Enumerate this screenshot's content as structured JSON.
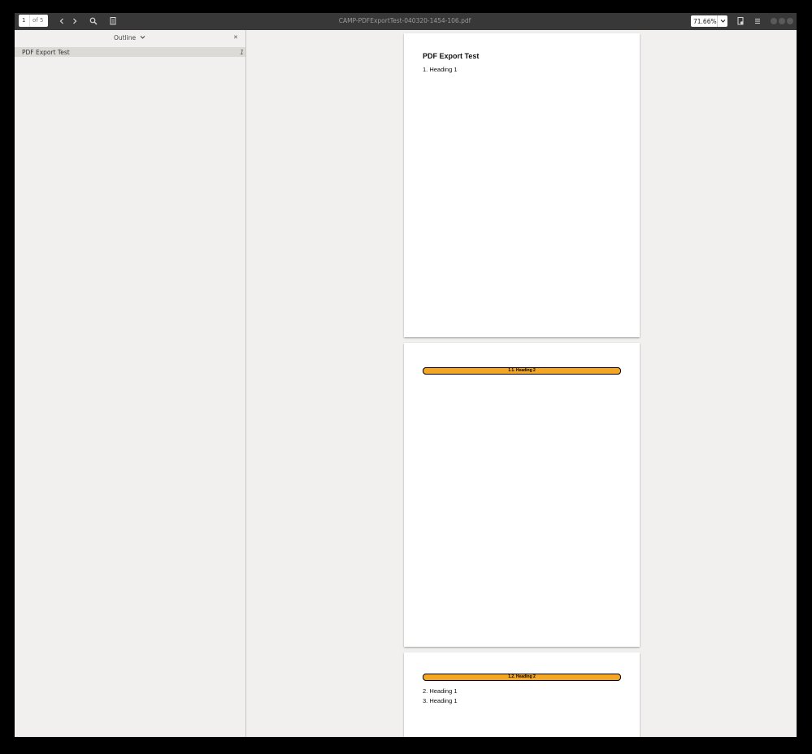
{
  "toolbar": {
    "page_number": "1",
    "page_count": "of 5",
    "title": "CAMP-PDFExportTest-040320-1454-106.pdf",
    "zoom": "71.66%"
  },
  "sidebar": {
    "mode": "Outline",
    "items": [
      {
        "label": "PDF Export Test",
        "page": "1"
      }
    ]
  },
  "pages": [
    {
      "title": "PDF Export Test",
      "lines": [
        "1. Heading 1"
      ]
    },
    {
      "heading2": "1.1. Heading 2"
    },
    {
      "heading2": "1.2. Heading 2",
      "lines": [
        "2. Heading 1",
        "3. Heading 1"
      ]
    }
  ],
  "colors": {
    "heading2_fill": "#f5a623",
    "titlebar": "#383838"
  },
  "icons": [
    "chevron-left-icon",
    "chevron-right-icon",
    "search-icon",
    "document-icon",
    "chevron-down-icon",
    "close-icon",
    "page-settings-icon",
    "menu-icon"
  ]
}
